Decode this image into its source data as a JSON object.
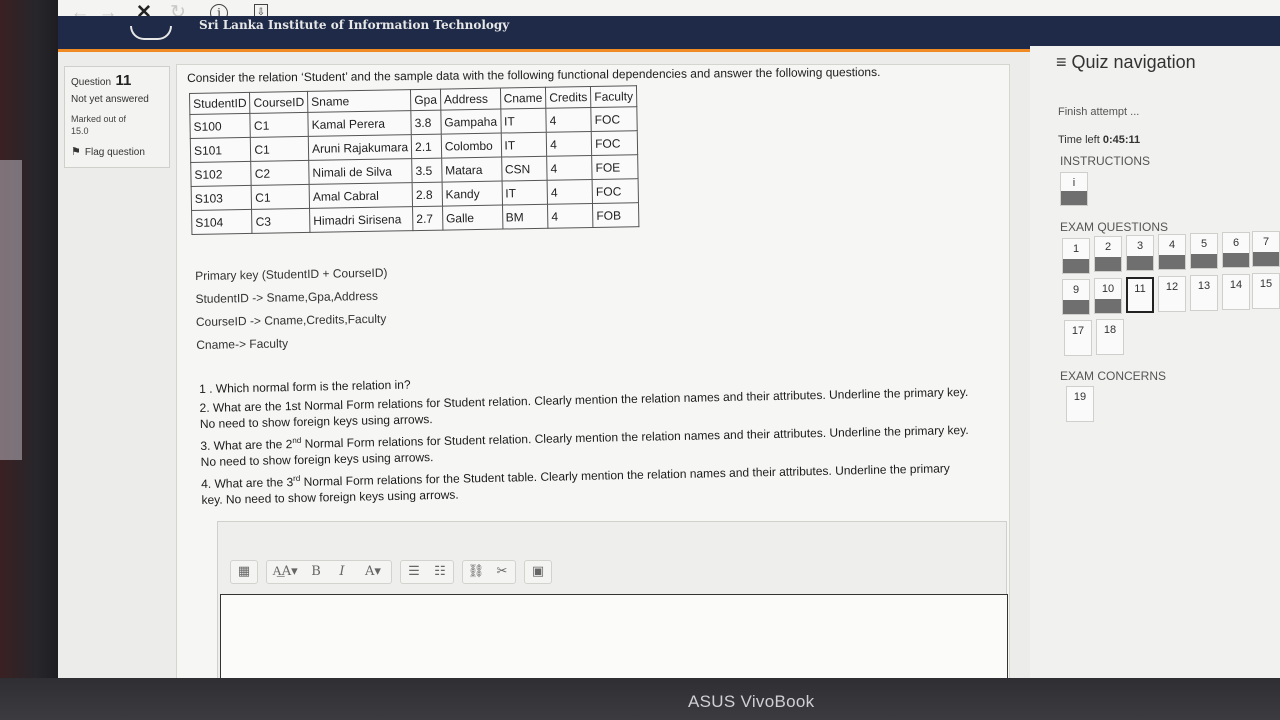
{
  "browser": {
    "back": "←",
    "forward": "→",
    "stop": "✕",
    "reload": "↻",
    "info": "i",
    "page_icon": "⇩"
  },
  "header": {
    "site_title": "Sri Lanka Institute of Information Technology"
  },
  "question_info": {
    "label": "Question",
    "number": "11",
    "state": "Not yet answered",
    "marks_line1": "Marked out of",
    "marks_line2": "15.0",
    "flag": "Flag question"
  },
  "question": {
    "intro": "Consider the relation ‘Student’ and the sample data with the following functional dependencies and answer the following questions.",
    "table": {
      "headers": [
        "StudentID",
        "CourseID",
        "Sname",
        "Gpa",
        "Address",
        "Cname",
        "Credits",
        "Faculty"
      ],
      "rows": [
        [
          "S100",
          "C1",
          "Kamal Perera",
          "3.8",
          "Gampaha",
          "IT",
          "4",
          "FOC"
        ],
        [
          "S101",
          "C1",
          "Aruni Rajakumara",
          "2.1",
          "Colombo",
          "IT",
          "4",
          "FOC"
        ],
        [
          "S102",
          "C2",
          "Nimali de Silva",
          "3.5",
          "Matara",
          "CSN",
          "4",
          "FOE"
        ],
        [
          "S103",
          "C1",
          "Amal Cabral",
          "2.8",
          "Kandy",
          "IT",
          "4",
          "FOC"
        ],
        [
          "S104",
          "C3",
          "Himadri Sirisena",
          "2.7",
          "Galle",
          "BM",
          "4",
          "FOB"
        ]
      ]
    },
    "dependencies": [
      "Primary key (StudentID + CourseID)",
      "StudentID -> Sname,Gpa,Address",
      "CourseID -> Cname,Credits,Faculty",
      "Cname-> Faculty"
    ],
    "sub_questions": {
      "q1": "1 . Which normal form is the relation in?",
      "q2": "2. What are the  1st Normal Form relations for Student relation. Clearly mention the relation names and their attributes. Underline the primary key. No need to show foreign keys using arrows.",
      "q3_pre": "3. What are the 2",
      "q3_sup": "nd",
      "q3_post": " Normal Form relations for Student relation. Clearly mention the relation names and their attributes. Underline the primary key. No need to show foreign keys using arrows.",
      "q4_pre": "4. What are the 3",
      "q4_sup": "rd",
      "q4_post": " Normal Form relations for the Student table. Clearly mention the relation names and their attributes. Underline the primary key. No need to show foreign keys using arrows."
    }
  },
  "editor": {
    "toolbar": {
      "toggle": "▦",
      "paragraph_style": "A͟A▾",
      "bold": "B",
      "italic": "I",
      "font": "A▾",
      "bullets": "☰",
      "numbers": "☷",
      "link": "⛓",
      "unlink": "✂",
      "image": "▣"
    }
  },
  "quiz_nav": {
    "title": "Quiz navigation",
    "menu_icon": "≡",
    "finish": "Finish attempt ...",
    "time_label": "Time left",
    "time_value": "0:45:11",
    "instructions_label": "INSTRUCTIONS",
    "instructions_btn": "i",
    "exam_questions_label": "EXAM QUESTIONS",
    "questions_row1": [
      "1",
      "2",
      "3",
      "4",
      "5",
      "6",
      "7"
    ],
    "questions_row2": [
      "9",
      "10",
      "11",
      "12",
      "13",
      "14",
      "15"
    ],
    "questions_row3": [
      "17",
      "18"
    ],
    "exam_concerns_label": "EXAM CONCERNS",
    "concerns": [
      "19"
    ]
  },
  "bezel": {
    "brand": "ASUS VivoBook"
  }
}
